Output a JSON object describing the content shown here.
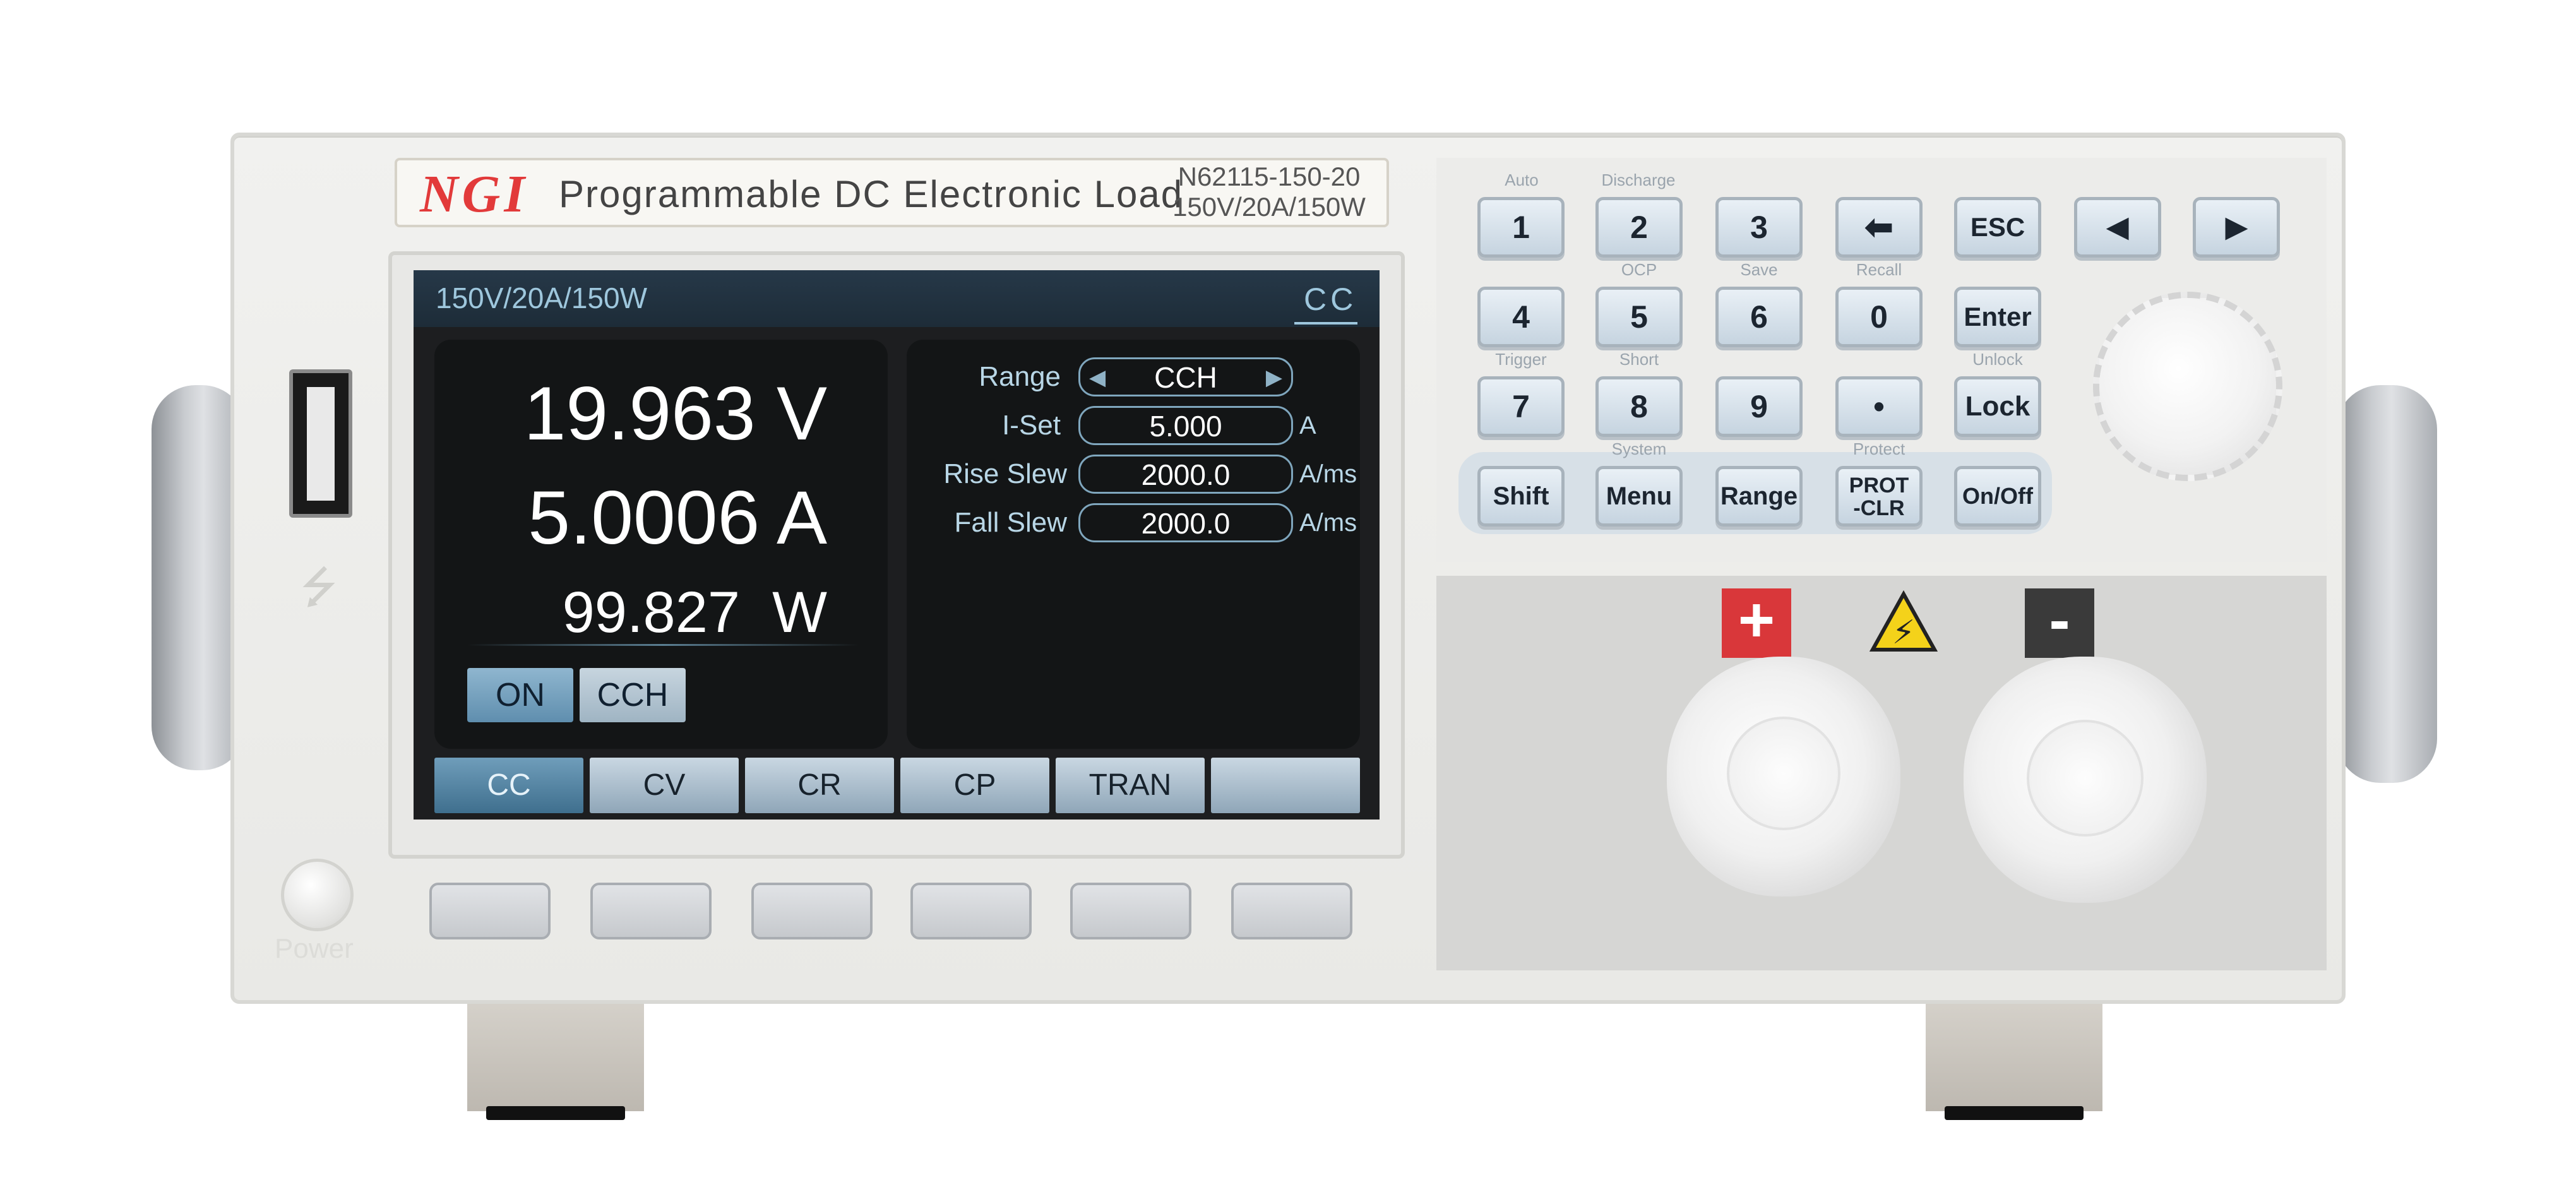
{
  "header": {
    "logo": "NGI",
    "product_title": "Programmable DC Electronic Load",
    "model": "N62115-150-20",
    "rating": "150V/20A/150W"
  },
  "front_panel": {
    "power_label": "Power"
  },
  "screen": {
    "top_rating": "150V/20A/150W",
    "mode_indicator": "CC",
    "measurements": {
      "voltage": "19.963 V",
      "current": "5.0006 A",
      "power": "99.827  W"
    },
    "status_chips": [
      "ON",
      "CCH"
    ],
    "params": [
      {
        "label": "Range",
        "value": "CCH",
        "unit": ""
      },
      {
        "label": "I-Set",
        "value": "5.000",
        "unit": "A"
      },
      {
        "label": "Rise Slew",
        "value": "2000.0",
        "unit": "A/ms"
      },
      {
        "label": "Fall Slew",
        "value": "2000.0",
        "unit": "A/ms"
      }
    ],
    "softkeys": [
      "CC",
      "CV",
      "CR",
      "CP",
      "TRAN",
      ""
    ]
  },
  "keypad": {
    "row1": [
      {
        "key": "1",
        "above": "Auto"
      },
      {
        "key": "2",
        "above": "Discharge"
      },
      {
        "key": "3",
        "above": ""
      },
      {
        "key": "⬅",
        "above": ""
      },
      {
        "key": "ESC",
        "above": ""
      },
      {
        "key": "◀",
        "above": ""
      },
      {
        "key": "▶",
        "above": ""
      }
    ],
    "row2": [
      {
        "key": "4",
        "above": ""
      },
      {
        "key": "5",
        "above": "OCP"
      },
      {
        "key": "6",
        "above": "Save"
      },
      {
        "key": "0",
        "above": "Recall"
      },
      {
        "key": "Enter",
        "above": ""
      }
    ],
    "row3": [
      {
        "key": "7",
        "above": "Trigger"
      },
      {
        "key": "8",
        "above": "Short"
      },
      {
        "key": "9",
        "above": ""
      },
      {
        "key": "•",
        "above": ""
      },
      {
        "key": "Lock",
        "above": "Unlock"
      }
    ],
    "row4": [
      {
        "key": "Shift",
        "above": ""
      },
      {
        "key": "Menu",
        "above": "System"
      },
      {
        "key": "Range",
        "above": ""
      },
      {
        "key": "PROT\n-CLR",
        "above": "Protect"
      },
      {
        "key": "On/Off",
        "above": ""
      }
    ]
  },
  "terminals": {
    "positive": "+",
    "negative": "-",
    "warning_symbol": "⚡"
  }
}
